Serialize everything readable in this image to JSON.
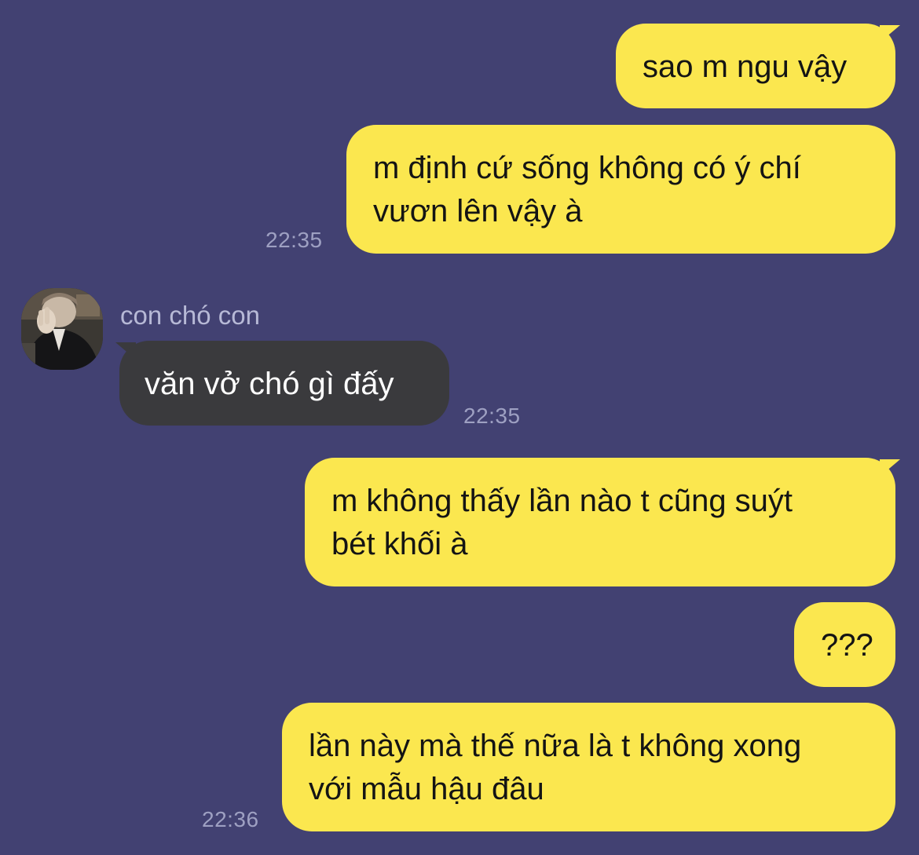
{
  "colors": {
    "background": "#424172",
    "outgoing_bubble": "#FBE74F",
    "incoming_bubble": "#3A3A3D",
    "timestamp": "#9EA0C2",
    "sender_name": "#B7B9D6"
  },
  "messages": [
    {
      "direction": "outgoing",
      "text": "sao m ngu vậy"
    },
    {
      "direction": "outgoing",
      "text": "m định cứ sống không có ý chí\nvươn lên vậy à",
      "time": "22:35"
    },
    {
      "direction": "incoming",
      "sender": "con chó con",
      "avatar": "profile-photo",
      "text": "văn vở chó gì đấy",
      "time": "22:35"
    },
    {
      "direction": "outgoing",
      "text": "m không thấy lần nào t cũng suýt\nbét khối à"
    },
    {
      "direction": "outgoing",
      "text": "???"
    },
    {
      "direction": "outgoing",
      "text": "lần này mà thế nữa là t không xong\nvới mẫu hậu đâu",
      "time": "22:36"
    }
  ]
}
